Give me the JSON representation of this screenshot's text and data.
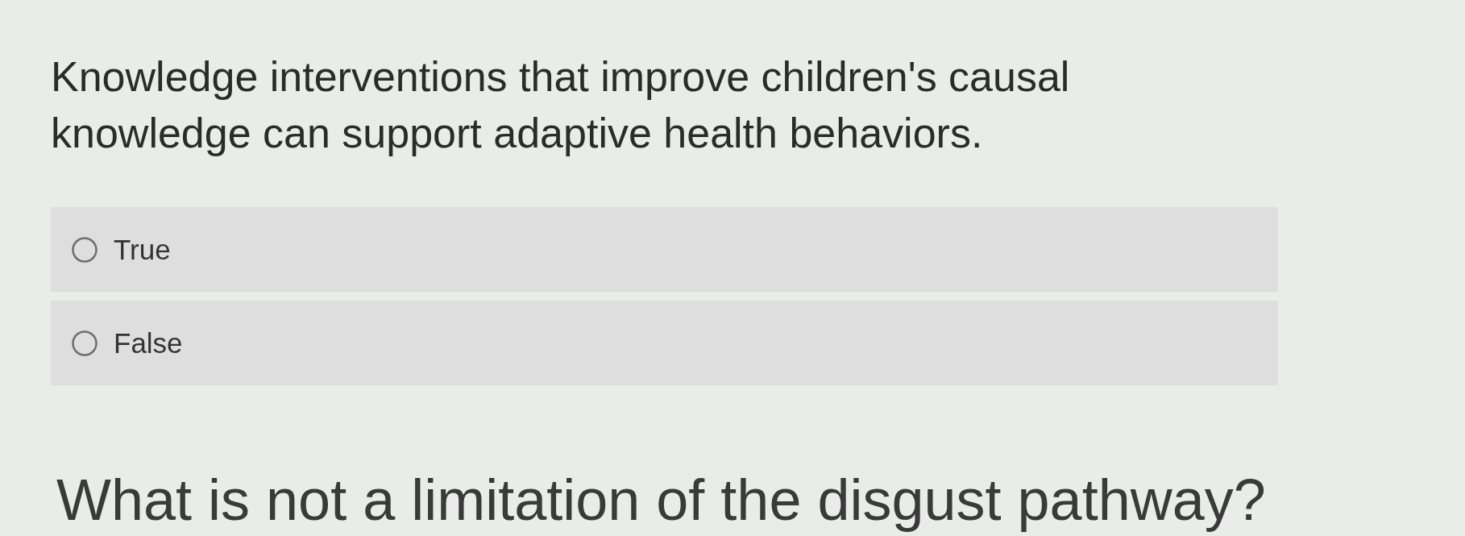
{
  "question": {
    "text": "Knowledge interventions that improve children's causal knowledge can support adaptive health behaviors."
  },
  "options": [
    {
      "label": "True",
      "selected": false
    },
    {
      "label": "False",
      "selected": false
    }
  ],
  "next_question": {
    "text": "What is not a limitation of the disgust pathway?"
  }
}
